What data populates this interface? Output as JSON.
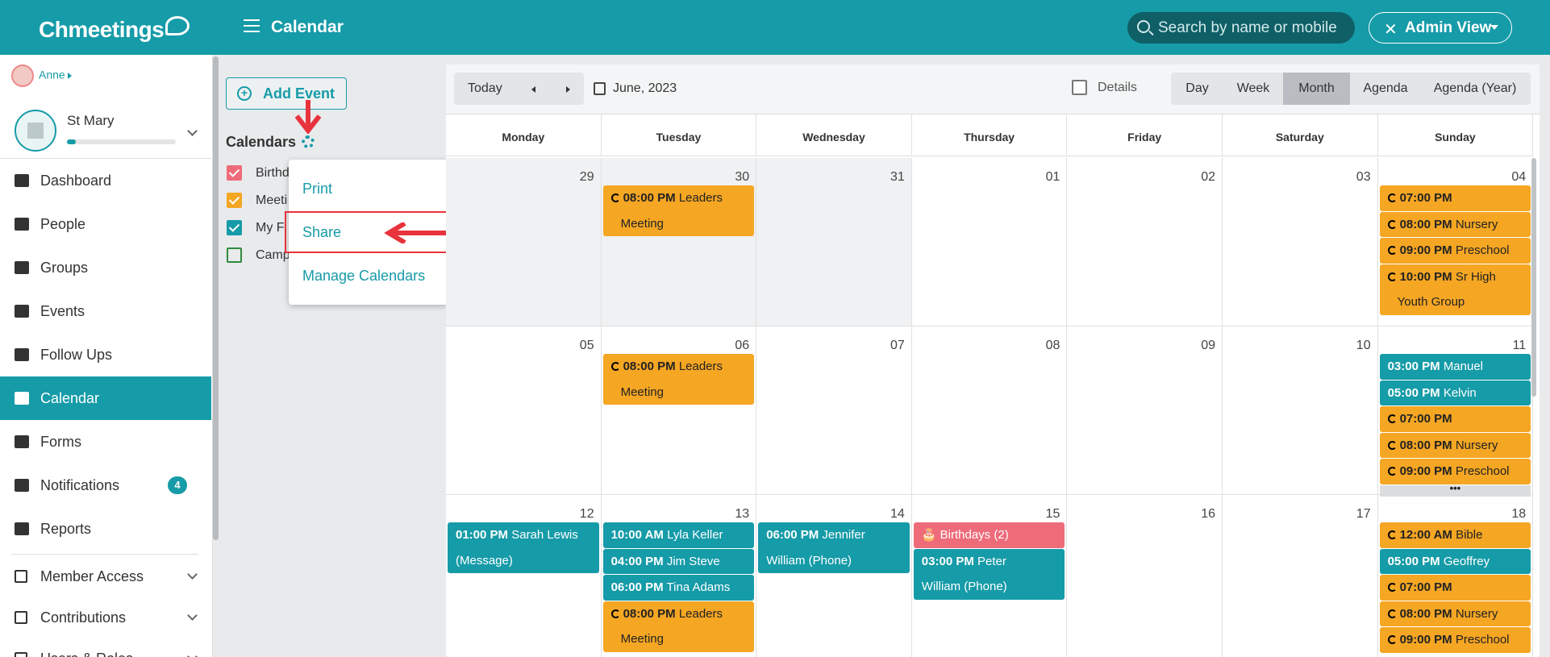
{
  "app": {
    "brand": "Chmeetings",
    "page_title": "Calendar"
  },
  "header": {
    "search_placeholder": "Search by name or mobile",
    "admin_label": "Admin View"
  },
  "user": {
    "name": "Anne"
  },
  "church": {
    "name": "St Mary",
    "progress_percent": 8
  },
  "nav": {
    "items": [
      {
        "label": "Dashboard",
        "icon": "chart-line-icon"
      },
      {
        "label": "People",
        "icon": "person-icon"
      },
      {
        "label": "Groups",
        "icon": "users-icon"
      },
      {
        "label": "Events",
        "icon": "calendar-icon"
      },
      {
        "label": "Follow Ups",
        "icon": "handshake-icon"
      },
      {
        "label": "Calendar",
        "icon": "calendar-grid-icon",
        "active": true
      },
      {
        "label": "Forms",
        "icon": "list-icon"
      },
      {
        "label": "Notifications",
        "icon": "bell-icon",
        "badge": "4"
      },
      {
        "label": "Reports",
        "icon": "bar-chart-icon"
      }
    ],
    "sub_items": [
      {
        "label": "Member Access",
        "icon": "mobile-icon"
      },
      {
        "label": "Contributions",
        "icon": "money-icon"
      },
      {
        "label": "Users & Roles",
        "icon": "users-gear-icon"
      }
    ]
  },
  "calendars": {
    "add_event_label": "Add Event",
    "heading": "Calendars",
    "items": [
      {
        "label": "Birthd",
        "color": "#ee6b7a",
        "checked": true
      },
      {
        "label": "Meeti",
        "color": "#f5a623",
        "checked": true
      },
      {
        "label": "My F",
        "color": "#169ba8",
        "checked": true
      },
      {
        "label": "Camp",
        "color": "#2e8b3d",
        "checked": false
      }
    ],
    "menu": {
      "print": "Print",
      "share": "Share",
      "manage": "Manage Calendars"
    }
  },
  "toolbar": {
    "today": "Today",
    "date": "June, 2023",
    "details_label": "Details",
    "views": [
      "Day",
      "Week",
      "Month",
      "Agenda",
      "Agenda (Year)"
    ],
    "active_view": "Month"
  },
  "weekdays": [
    "Monday",
    "Tuesday",
    "Wednesday",
    "Thursday",
    "Friday",
    "Saturday",
    "Sunday"
  ],
  "weeks": [
    [
      {
        "day": "29",
        "out": true,
        "events": []
      },
      {
        "day": "30",
        "out": true,
        "events": [
          {
            "time": "08:00 PM",
            "title": "Leaders",
            "cont": "Meeting",
            "color": "orange",
            "rec": true
          }
        ]
      },
      {
        "day": "31",
        "out": true,
        "events": []
      },
      {
        "day": "01",
        "events": []
      },
      {
        "day": "02",
        "events": []
      },
      {
        "day": "03",
        "events": []
      },
      {
        "day": "04",
        "events": [
          {
            "time": "07:00 PM",
            "title": "",
            "color": "orange",
            "rec": true
          },
          {
            "time": "08:00 PM",
            "title": "Nursery",
            "color": "orange",
            "rec": true
          },
          {
            "time": "09:00 PM",
            "title": "Preschool",
            "color": "orange",
            "rec": true
          },
          {
            "time": "10:00 PM",
            "title": "Sr High",
            "cont": "Youth Group",
            "color": "orange",
            "rec": true
          }
        ]
      }
    ],
    [
      {
        "day": "05",
        "events": []
      },
      {
        "day": "06",
        "events": [
          {
            "time": "08:00 PM",
            "title": "Leaders",
            "cont": "Meeting",
            "color": "orange",
            "rec": true
          }
        ]
      },
      {
        "day": "07",
        "events": []
      },
      {
        "day": "08",
        "events": []
      },
      {
        "day": "09",
        "events": []
      },
      {
        "day": "10",
        "events": []
      },
      {
        "day": "11",
        "more": "•••",
        "events": [
          {
            "time": "03:00 PM",
            "title": "Manuel",
            "color": "teal"
          },
          {
            "time": "05:00 PM",
            "title": "Kelvin",
            "color": "teal"
          },
          {
            "time": "07:00 PM",
            "title": "",
            "color": "orange",
            "rec": true
          },
          {
            "time": "08:00 PM",
            "title": "Nursery",
            "color": "orange",
            "rec": true
          },
          {
            "time": "09:00 PM",
            "title": "Preschool",
            "color": "orange",
            "rec": true
          }
        ]
      }
    ],
    [
      {
        "day": "12",
        "events": [
          {
            "time": "01:00 PM",
            "title": "Sarah Lewis",
            "cont": "(Message)",
            "color": "teal"
          }
        ]
      },
      {
        "day": "13",
        "events": [
          {
            "time": "10:00 AM",
            "title": "Lyla Keller",
            "color": "teal"
          },
          {
            "time": "04:00 PM",
            "title": "Jim Steve",
            "color": "teal"
          },
          {
            "time": "06:00 PM",
            "title": "Tina Adams",
            "color": "teal"
          },
          {
            "time": "08:00 PM",
            "title": "Leaders",
            "cont": "Meeting",
            "color": "orange",
            "rec": true
          }
        ]
      },
      {
        "day": "14",
        "events": [
          {
            "time": "06:00 PM",
            "title": "Jennifer",
            "cont": "William (Phone)",
            "color": "teal"
          }
        ]
      },
      {
        "day": "15",
        "events": [
          {
            "time": "",
            "title": "Birthdays (2)",
            "color": "pink",
            "cake": true
          },
          {
            "time": "03:00 PM",
            "title": "Peter",
            "cont": "William (Phone)",
            "color": "teal"
          }
        ]
      },
      {
        "day": "16",
        "events": []
      },
      {
        "day": "17",
        "events": []
      },
      {
        "day": "18",
        "events": [
          {
            "time": "12:00 AM",
            "title": "Bible",
            "color": "orange",
            "rec": true
          },
          {
            "time": "05:00 PM",
            "title": "Geoffrey",
            "color": "teal"
          },
          {
            "time": "07:00 PM",
            "title": "",
            "color": "orange",
            "rec": true
          },
          {
            "time": "08:00 PM",
            "title": "Nursery",
            "color": "orange",
            "rec": true
          },
          {
            "time": "09:00 PM",
            "title": "Preschool",
            "color": "orange",
            "rec": true
          }
        ]
      }
    ]
  ]
}
